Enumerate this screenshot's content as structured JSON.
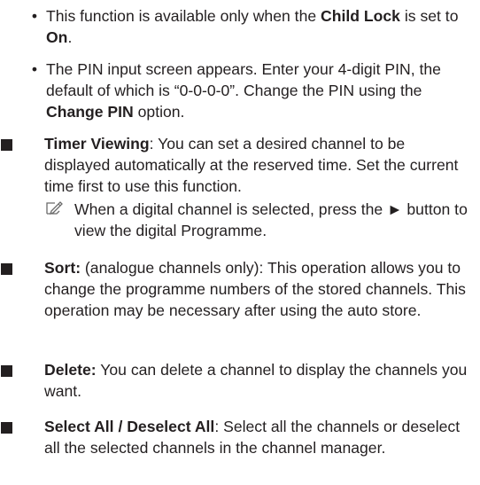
{
  "bullets_top": [
    {
      "dot": "•",
      "parts": [
        "This function is available only when the ",
        "Child Lock",
        " is set to ",
        "On",
        "."
      ]
    },
    {
      "dot": "•",
      "parts": [
        "The PIN input screen appears. Enter your 4-digit PIN, the default of which is “0-0-0-0”. Change the PIN using the ",
        "Change PIN",
        " option."
      ]
    }
  ],
  "items": [
    {
      "title": "Timer Viewing",
      "text": ": You can set a desired channel to be displayed automatically at the reserved time. Set the current time first to use this function."
    },
    {
      "title": "Sort:",
      "text": " (analogue channels only): This operation allows you to change the programme numbers of the stored channels. This operation may be necessary after using the auto store."
    },
    {
      "title": "Delete:",
      "text": " You can delete a channel to display the channels you want."
    },
    {
      "title": "Select All / Deselect All",
      "text": ": Select all the channels or deselect all the selected channels in the channel manager."
    }
  ],
  "note": {
    "icon": "note-pencil-icon",
    "text_before": "When a digital channel is selected, press the ",
    "arrow": "►",
    "text_after": " button to view the digital Programme."
  },
  "colors": {
    "text": "#231f20"
  }
}
